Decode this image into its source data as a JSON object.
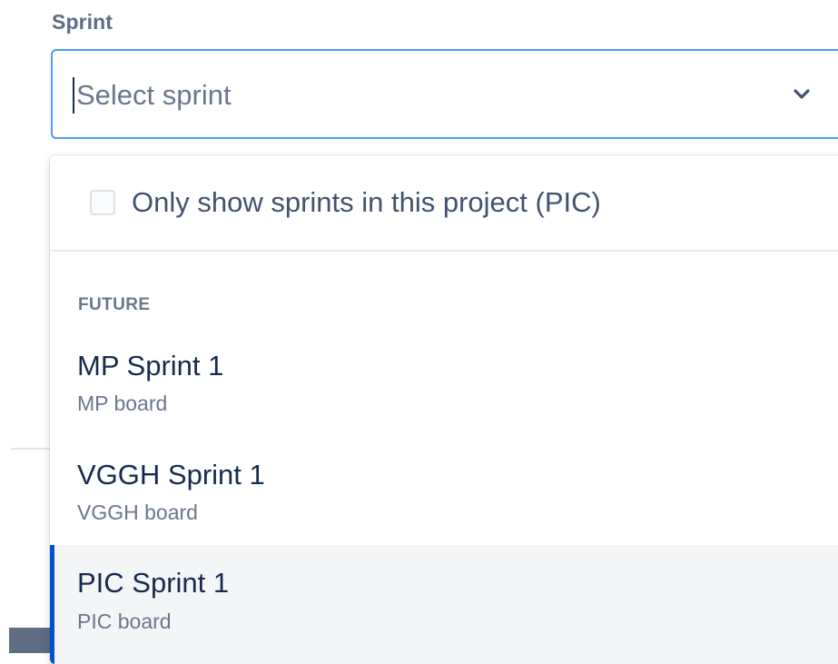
{
  "field": {
    "label": "Sprint",
    "placeholder": "Select sprint"
  },
  "dropdown": {
    "filter_label": "Only show sprints in this project (PIC)",
    "filter_checked": false,
    "group": "FUTURE",
    "options": [
      {
        "title": "MP Sprint 1",
        "board": "MP board",
        "selected": false
      },
      {
        "title": "VGGH Sprint 1",
        "board": "VGGH board",
        "selected": false
      },
      {
        "title": "PIC Sprint 1",
        "board": "PIC board",
        "selected": true
      }
    ]
  },
  "colors": {
    "focus_border": "#4c9aff",
    "selected_accent": "#0052cc",
    "selected_bg": "#f4f5f7"
  },
  "icons": {
    "dropdown": "chevron-down-icon"
  }
}
